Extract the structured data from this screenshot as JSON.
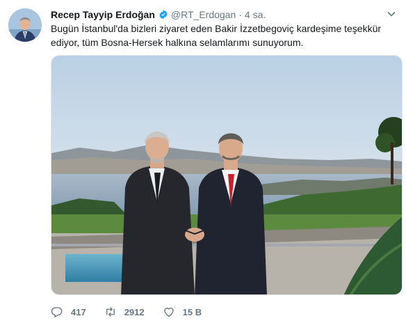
{
  "tweet": {
    "author_name": "Recep Tayyip Erdoğan",
    "handle": "@RT_Erdogan",
    "separator": "·",
    "time": "4 sa.",
    "text": "Bugün İstanbul'da bizleri ziyaret eden Bakir İzzetbegoviç kardeşime teşekkür ediyor, tüm Bosna-Hersek halkına selamlarımı sunuyorum.",
    "photo": "two-men-shaking-hands-on-terrace-above-bosphorus"
  },
  "actions": {
    "replies": "417",
    "retweets": "2912",
    "likes": "15 B"
  },
  "colors": {
    "verified": "#1da1f2",
    "muted_text": "#657786",
    "text": "#14171a"
  },
  "icons": {
    "verified": "verified-badge-icon",
    "caret": "chevron-down-icon",
    "reply": "reply-icon",
    "retweet": "retweet-icon",
    "like": "heart-icon"
  }
}
